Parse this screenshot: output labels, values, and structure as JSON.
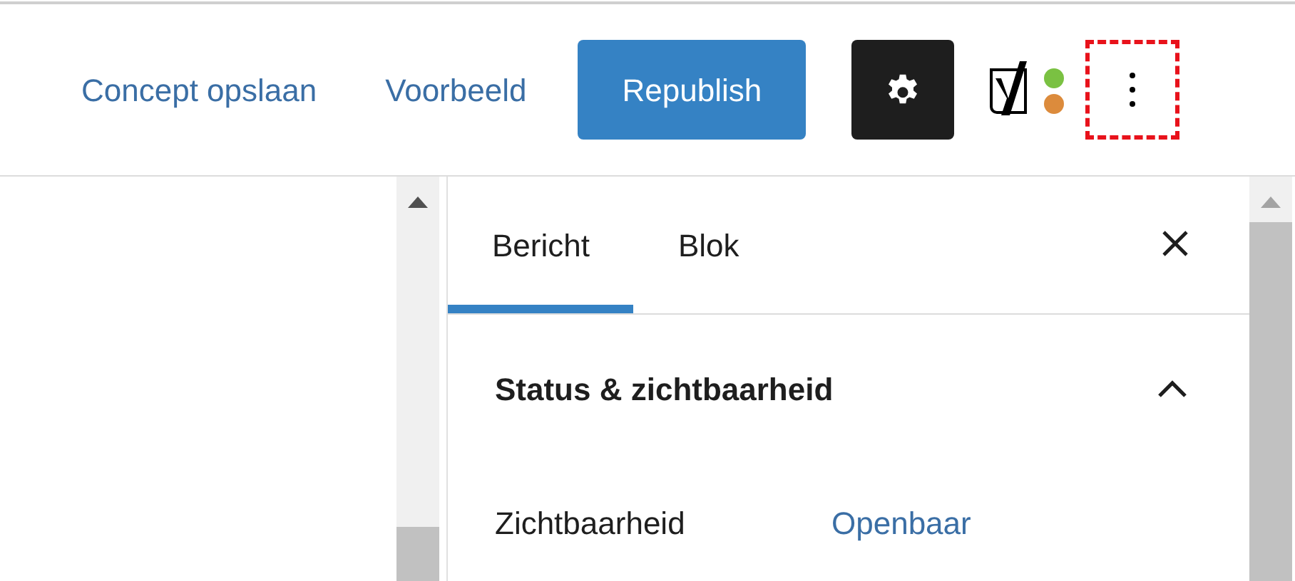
{
  "toolbar": {
    "save_draft": "Concept opslaan",
    "preview": "Voorbeeld",
    "publish": "Republish",
    "settings": {
      "selected": true
    },
    "more": {
      "highlighted": true
    }
  },
  "sidebar": {
    "tabs": [
      {
        "label": "Bericht",
        "selected": true
      },
      {
        "label": "Blok",
        "selected": false
      }
    ],
    "panel": {
      "title": "Status & zichtbaarheid",
      "expanded": true,
      "rows": [
        {
          "label": "Zichtbaarheid",
          "value": "Openbaar"
        }
      ]
    }
  }
}
